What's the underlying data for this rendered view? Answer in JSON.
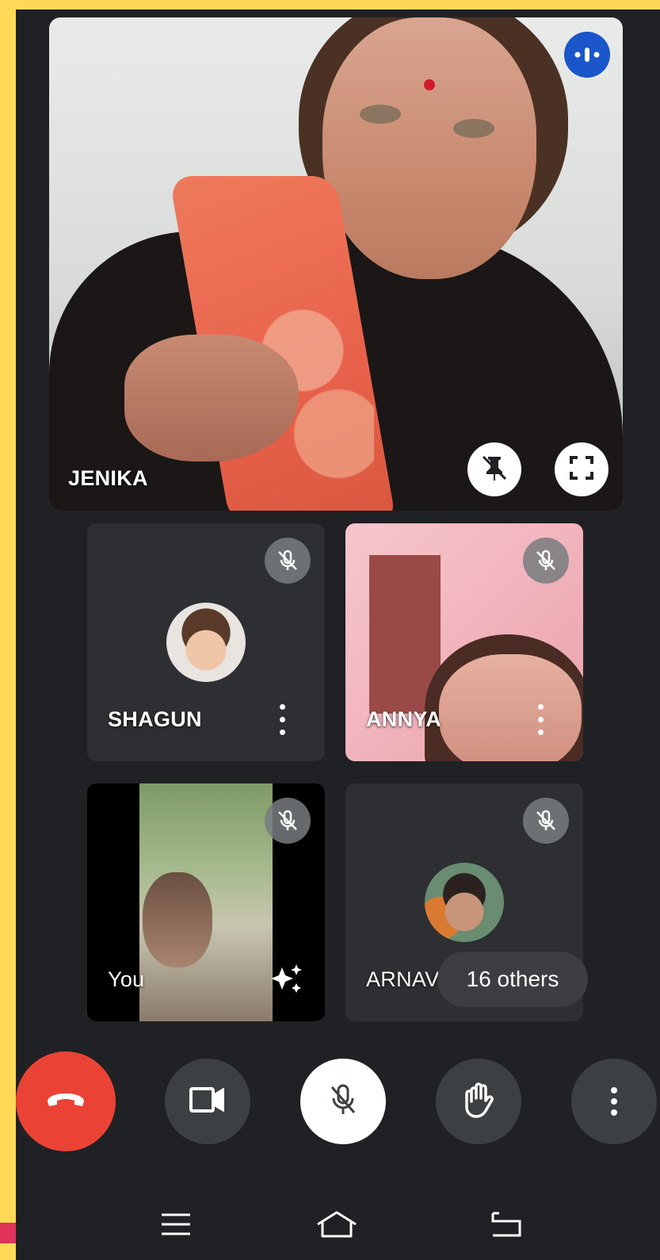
{
  "participants": {
    "main": {
      "name": "JENIKA"
    },
    "tile1": {
      "name": "SHAGUN"
    },
    "tile2": {
      "name": "ANNYA"
    },
    "tile3": {
      "name": "You"
    },
    "tile4": {
      "name": "ARNAV"
    }
  },
  "others_chip": {
    "label": "16 others"
  },
  "icons": {
    "speaking": "audio-level-icon",
    "unpin": "unpin-icon",
    "fullscreen": "fullscreen-icon",
    "muted": "mic-off-icon",
    "more": "more-vert-icon",
    "effects": "sparkle-effects-icon",
    "end_call": "call-end-icon",
    "camera": "videocam-icon",
    "mic": "mic-off-icon",
    "hand": "raise-hand-icon",
    "nav_menu": "menu-icon",
    "nav_home": "home-icon",
    "nav_back": "back-icon"
  },
  "colors": {
    "background": "#202124",
    "end_call": "#ea4335",
    "speaking_badge": "#1a56c9",
    "frame": "#ffd858"
  }
}
